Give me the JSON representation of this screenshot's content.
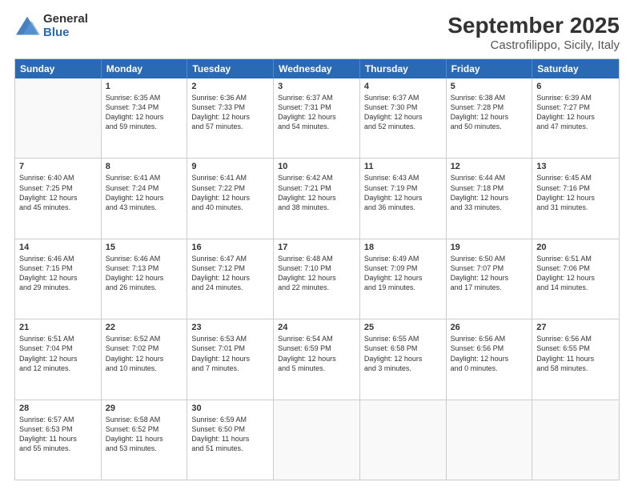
{
  "logo": {
    "general": "General",
    "blue": "Blue"
  },
  "title": "September 2025",
  "subtitle": "Castrofilippo, Sicily, Italy",
  "days": [
    "Sunday",
    "Monday",
    "Tuesday",
    "Wednesday",
    "Thursday",
    "Friday",
    "Saturday"
  ],
  "weeks": [
    [
      {
        "day": "",
        "lines": []
      },
      {
        "day": "1",
        "lines": [
          "Sunrise: 6:35 AM",
          "Sunset: 7:34 PM",
          "Daylight: 12 hours",
          "and 59 minutes."
        ]
      },
      {
        "day": "2",
        "lines": [
          "Sunrise: 6:36 AM",
          "Sunset: 7:33 PM",
          "Daylight: 12 hours",
          "and 57 minutes."
        ]
      },
      {
        "day": "3",
        "lines": [
          "Sunrise: 6:37 AM",
          "Sunset: 7:31 PM",
          "Daylight: 12 hours",
          "and 54 minutes."
        ]
      },
      {
        "day": "4",
        "lines": [
          "Sunrise: 6:37 AM",
          "Sunset: 7:30 PM",
          "Daylight: 12 hours",
          "and 52 minutes."
        ]
      },
      {
        "day": "5",
        "lines": [
          "Sunrise: 6:38 AM",
          "Sunset: 7:28 PM",
          "Daylight: 12 hours",
          "and 50 minutes."
        ]
      },
      {
        "day": "6",
        "lines": [
          "Sunrise: 6:39 AM",
          "Sunset: 7:27 PM",
          "Daylight: 12 hours",
          "and 47 minutes."
        ]
      }
    ],
    [
      {
        "day": "7",
        "lines": [
          "Sunrise: 6:40 AM",
          "Sunset: 7:25 PM",
          "Daylight: 12 hours",
          "and 45 minutes."
        ]
      },
      {
        "day": "8",
        "lines": [
          "Sunrise: 6:41 AM",
          "Sunset: 7:24 PM",
          "Daylight: 12 hours",
          "and 43 minutes."
        ]
      },
      {
        "day": "9",
        "lines": [
          "Sunrise: 6:41 AM",
          "Sunset: 7:22 PM",
          "Daylight: 12 hours",
          "and 40 minutes."
        ]
      },
      {
        "day": "10",
        "lines": [
          "Sunrise: 6:42 AM",
          "Sunset: 7:21 PM",
          "Daylight: 12 hours",
          "and 38 minutes."
        ]
      },
      {
        "day": "11",
        "lines": [
          "Sunrise: 6:43 AM",
          "Sunset: 7:19 PM",
          "Daylight: 12 hours",
          "and 36 minutes."
        ]
      },
      {
        "day": "12",
        "lines": [
          "Sunrise: 6:44 AM",
          "Sunset: 7:18 PM",
          "Daylight: 12 hours",
          "and 33 minutes."
        ]
      },
      {
        "day": "13",
        "lines": [
          "Sunrise: 6:45 AM",
          "Sunset: 7:16 PM",
          "Daylight: 12 hours",
          "and 31 minutes."
        ]
      }
    ],
    [
      {
        "day": "14",
        "lines": [
          "Sunrise: 6:46 AM",
          "Sunset: 7:15 PM",
          "Daylight: 12 hours",
          "and 29 minutes."
        ]
      },
      {
        "day": "15",
        "lines": [
          "Sunrise: 6:46 AM",
          "Sunset: 7:13 PM",
          "Daylight: 12 hours",
          "and 26 minutes."
        ]
      },
      {
        "day": "16",
        "lines": [
          "Sunrise: 6:47 AM",
          "Sunset: 7:12 PM",
          "Daylight: 12 hours",
          "and 24 minutes."
        ]
      },
      {
        "day": "17",
        "lines": [
          "Sunrise: 6:48 AM",
          "Sunset: 7:10 PM",
          "Daylight: 12 hours",
          "and 22 minutes."
        ]
      },
      {
        "day": "18",
        "lines": [
          "Sunrise: 6:49 AM",
          "Sunset: 7:09 PM",
          "Daylight: 12 hours",
          "and 19 minutes."
        ]
      },
      {
        "day": "19",
        "lines": [
          "Sunrise: 6:50 AM",
          "Sunset: 7:07 PM",
          "Daylight: 12 hours",
          "and 17 minutes."
        ]
      },
      {
        "day": "20",
        "lines": [
          "Sunrise: 6:51 AM",
          "Sunset: 7:06 PM",
          "Daylight: 12 hours",
          "and 14 minutes."
        ]
      }
    ],
    [
      {
        "day": "21",
        "lines": [
          "Sunrise: 6:51 AM",
          "Sunset: 7:04 PM",
          "Daylight: 12 hours",
          "and 12 minutes."
        ]
      },
      {
        "day": "22",
        "lines": [
          "Sunrise: 6:52 AM",
          "Sunset: 7:02 PM",
          "Daylight: 12 hours",
          "and 10 minutes."
        ]
      },
      {
        "day": "23",
        "lines": [
          "Sunrise: 6:53 AM",
          "Sunset: 7:01 PM",
          "Daylight: 12 hours",
          "and 7 minutes."
        ]
      },
      {
        "day": "24",
        "lines": [
          "Sunrise: 6:54 AM",
          "Sunset: 6:59 PM",
          "Daylight: 12 hours",
          "and 5 minutes."
        ]
      },
      {
        "day": "25",
        "lines": [
          "Sunrise: 6:55 AM",
          "Sunset: 6:58 PM",
          "Daylight: 12 hours",
          "and 3 minutes."
        ]
      },
      {
        "day": "26",
        "lines": [
          "Sunrise: 6:56 AM",
          "Sunset: 6:56 PM",
          "Daylight: 12 hours",
          "and 0 minutes."
        ]
      },
      {
        "day": "27",
        "lines": [
          "Sunrise: 6:56 AM",
          "Sunset: 6:55 PM",
          "Daylight: 11 hours",
          "and 58 minutes."
        ]
      }
    ],
    [
      {
        "day": "28",
        "lines": [
          "Sunrise: 6:57 AM",
          "Sunset: 6:53 PM",
          "Daylight: 11 hours",
          "and 55 minutes."
        ]
      },
      {
        "day": "29",
        "lines": [
          "Sunrise: 6:58 AM",
          "Sunset: 6:52 PM",
          "Daylight: 11 hours",
          "and 53 minutes."
        ]
      },
      {
        "day": "30",
        "lines": [
          "Sunrise: 6:59 AM",
          "Sunset: 6:50 PM",
          "Daylight: 11 hours",
          "and 51 minutes."
        ]
      },
      {
        "day": "",
        "lines": []
      },
      {
        "day": "",
        "lines": []
      },
      {
        "day": "",
        "lines": []
      },
      {
        "day": "",
        "lines": []
      }
    ]
  ]
}
